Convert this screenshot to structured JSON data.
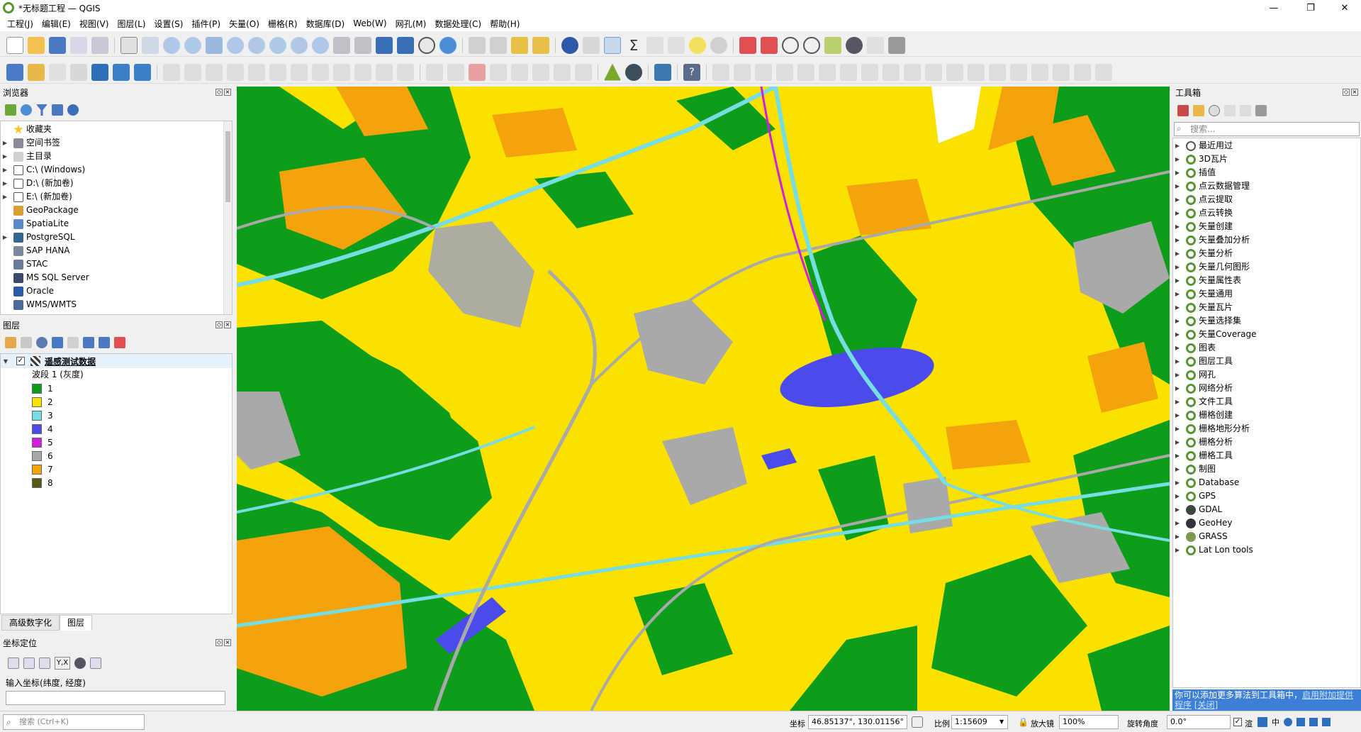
{
  "window": {
    "title": "*无标题工程 — QGIS",
    "min": "—",
    "max": "❐",
    "close": "✕"
  },
  "menu": [
    "工程(J)",
    "编辑(E)",
    "视图(V)",
    "图层(L)",
    "设置(S)",
    "插件(P)",
    "矢量(O)",
    "栅格(R)",
    "数据库(D)",
    "Web(W)",
    "网孔(M)",
    "数据处理(C)",
    "帮助(H)"
  ],
  "browser": {
    "title": "浏览器",
    "items": [
      "收藏夹",
      "空间书签",
      "主目录",
      "C:\\ (Windows)",
      "D:\\ (新加卷)",
      "E:\\ (新加卷)",
      "GeoPackage",
      "SpatiaLite",
      "PostgreSQL",
      "SAP HANA",
      "STAC",
      "MS SQL Server",
      "Oracle",
      "WMS/WMTS"
    ],
    "icons": [
      "star-icon",
      "bookmark-icon",
      "home-folder-icon",
      "folder-icon",
      "folder-icon",
      "folder-icon",
      "geopackage-icon",
      "spatialite-icon",
      "postgresql-icon",
      "sap-hana-icon",
      "stac-icon",
      "mssql-icon",
      "oracle-icon",
      "wms-icon"
    ],
    "expandable": [
      false,
      true,
      true,
      true,
      true,
      true,
      false,
      false,
      true,
      false,
      false,
      false,
      false,
      false
    ]
  },
  "layers": {
    "title": "图层",
    "layer_name": "遥感测试数据",
    "band_label": "波段 1 (灰度)",
    "legend": [
      {
        "label": "1",
        "color": "#0e9d1a"
      },
      {
        "label": "2",
        "color": "#fae100"
      },
      {
        "label": "3",
        "color": "#76dde2"
      },
      {
        "label": "4",
        "color": "#4b4bec"
      },
      {
        "label": "5",
        "color": "#d01ee0"
      },
      {
        "label": "6",
        "color": "#a9a9a9"
      },
      {
        "label": "7",
        "color": "#f5a30c"
      },
      {
        "label": "8",
        "color": "#565a12"
      }
    ]
  },
  "tabs": [
    "高级数字化",
    "图层"
  ],
  "coord_panel": {
    "title": "坐标定位",
    "input_label": "输入坐标(纬度, 经度)",
    "yx_label": "Y,X"
  },
  "search": {
    "placeholder": "搜索 (Ctrl+K)"
  },
  "toolbox": {
    "title": "工具箱",
    "search_placeholder": "搜索...",
    "items": [
      "最近用过",
      "3D瓦片",
      "插值",
      "点云数据管理",
      "点云提取",
      "点云转换",
      "矢量创建",
      "矢量叠加分析",
      "矢量分析",
      "矢量几何图形",
      "矢量属性表",
      "矢量通用",
      "矢量瓦片",
      "矢量选择集",
      "矢量Coverage",
      "图表",
      "图层工具",
      "网孔",
      "网络分析",
      "文件工具",
      "栅格创建",
      "栅格地形分析",
      "栅格分析",
      "栅格工具",
      "制图",
      "Database",
      "GPS",
      "GDAL",
      "GeoHey",
      "GRASS",
      "Lat Lon tools"
    ],
    "notice": "你可以添加更多算法到工具箱中，",
    "notice_link": "启用附加提供程序",
    "notice_close": "[关闭]"
  },
  "status": {
    "coord_label": "坐标",
    "coord_value": "46.85137°, 130.01156°",
    "scale_label": "比例",
    "scale_value": "1:15609",
    "magnifier_label": "放大镜",
    "magnifier_value": "100%",
    "rotation_label": "旋转角度",
    "rotation_value": "0.0°",
    "render_label": "渲",
    "ime": "中"
  },
  "colors": {
    "accent": "#589632",
    "map_bg": "#fae100",
    "notice_bg": "#3d7fd6"
  }
}
